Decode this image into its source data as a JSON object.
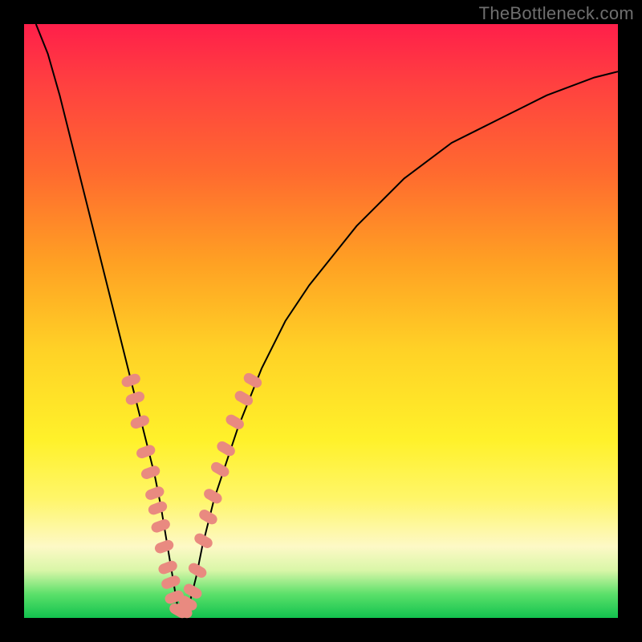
{
  "watermark": "TheBottleneck.com",
  "colors": {
    "background": "#000000",
    "gradient_top": "#ff1f4a",
    "gradient_bottom": "#12c24e",
    "curve": "#000000",
    "marker": "#e98a80"
  },
  "chart_data": {
    "type": "line",
    "title": "",
    "xlabel": "",
    "ylabel": "",
    "xlim": [
      0,
      100
    ],
    "ylim": [
      0,
      100
    ],
    "note": "Axes unlabeled in source; values are pixel-normalized percentages (0–100). y=0 is bottom / green (best), y=100 is top / red (worst). The curve is a V-shaped bottleneck profile with minimum near x≈26.",
    "series": [
      {
        "name": "bottleneck-curve",
        "x": [
          2,
          4,
          6,
          8,
          10,
          12,
          14,
          16,
          18,
          20,
          22,
          23,
          24,
          25,
          26,
          27,
          28,
          29,
          30,
          32,
          34,
          36,
          38,
          40,
          44,
          48,
          52,
          56,
          60,
          64,
          68,
          72,
          76,
          80,
          84,
          88,
          92,
          96,
          100
        ],
        "y": [
          100,
          95,
          88,
          80,
          72,
          64,
          56,
          48,
          40,
          32,
          24,
          19,
          13,
          7,
          1,
          1,
          3,
          7,
          12,
          20,
          26,
          32,
          37,
          42,
          50,
          56,
          61,
          66,
          70,
          74,
          77,
          80,
          82,
          84,
          86,
          88,
          89.5,
          91,
          92
        ]
      }
    ],
    "markers": {
      "name": "salmon-dots",
      "points": [
        {
          "x": 18.0,
          "y": 40
        },
        {
          "x": 18.7,
          "y": 37
        },
        {
          "x": 19.5,
          "y": 33
        },
        {
          "x": 20.5,
          "y": 28
        },
        {
          "x": 21.3,
          "y": 24.5
        },
        {
          "x": 22.0,
          "y": 21
        },
        {
          "x": 22.5,
          "y": 18.5
        },
        {
          "x": 23.0,
          "y": 15.5
        },
        {
          "x": 23.6,
          "y": 12
        },
        {
          "x": 24.2,
          "y": 8.5
        },
        {
          "x": 24.7,
          "y": 6
        },
        {
          "x": 25.3,
          "y": 3.5
        },
        {
          "x": 26.0,
          "y": 1.2
        },
        {
          "x": 26.8,
          "y": 1.2
        },
        {
          "x": 27.6,
          "y": 2.5
        },
        {
          "x": 28.4,
          "y": 4.5
        },
        {
          "x": 29.2,
          "y": 8
        },
        {
          "x": 30.2,
          "y": 13
        },
        {
          "x": 31.0,
          "y": 17
        },
        {
          "x": 31.8,
          "y": 20.5
        },
        {
          "x": 33.0,
          "y": 25
        },
        {
          "x": 34.0,
          "y": 28.5
        },
        {
          "x": 35.5,
          "y": 33
        },
        {
          "x": 37.0,
          "y": 37
        },
        {
          "x": 38.5,
          "y": 40
        }
      ]
    }
  }
}
